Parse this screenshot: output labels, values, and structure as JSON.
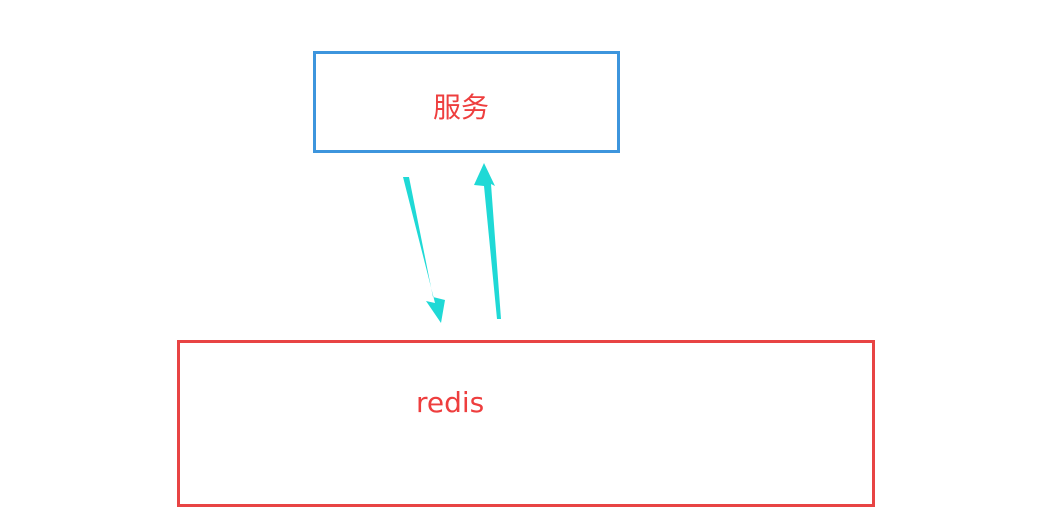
{
  "nodes": {
    "service": {
      "label": "服务",
      "border_color": "#3d95dd",
      "text_color": "#ee3e3e"
    },
    "redis": {
      "label": "redis",
      "border_color": "#e84444",
      "text_color": "#ee3e3e"
    }
  },
  "edges": [
    {
      "from": "service",
      "to": "redis",
      "color": "#1fd9d6"
    },
    {
      "from": "redis",
      "to": "service",
      "color": "#1fd9d6"
    }
  ]
}
